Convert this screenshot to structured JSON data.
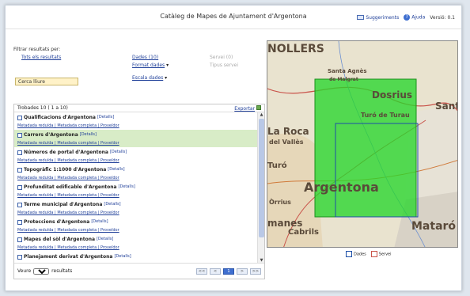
{
  "header": {
    "title": "Catàleg de Mapes de Ajuntament d'Argentona",
    "suggest_label": "Suggeriments",
    "help_label": "Ajuda",
    "version": "Versió: 0.1"
  },
  "filter": {
    "label": "Filtrar resultats per:",
    "all_results": "Tots els resultats",
    "dades": "Dades (10)",
    "servei": "Servei (0)",
    "format": "Format dades",
    "tipus": "Tipus servei",
    "escala": "Escala dades",
    "search_value": "Cerca lliure"
  },
  "results": {
    "count_label": "Trobades 10 ( 1 a 10)",
    "export_label": "Exportar",
    "detail_link": "[Detalls]",
    "links": "Metadada reduïda | Metadada completa | Proveïdor",
    "items": [
      {
        "title": "Qualificacions d'Argentona",
        "hl": false
      },
      {
        "title": "Carrers d'Argentona",
        "hl": true
      },
      {
        "title": "Números de portal d'Argentona",
        "hl": false
      },
      {
        "title": "Topogràfic 1:1000 d'Argentona",
        "hl": false
      },
      {
        "title": "Profunditat edificable d'Argentona",
        "hl": false
      },
      {
        "title": "Terme municipal d'Argentona",
        "hl": false
      },
      {
        "title": "Proteccions d'Argentona",
        "hl": false
      },
      {
        "title": "Mapes del sòl d'Argentona",
        "hl": false
      },
      {
        "title": "Planejament derivat d'Argentona",
        "hl": false
      }
    ],
    "pager_veure": "Veure",
    "pager_select": "25",
    "pager_suffix": "resultats",
    "pager_buttons": [
      "<<",
      "<",
      "1",
      ">",
      ">>"
    ]
  },
  "map": {
    "labels": [
      "NOLLERS",
      "Santa Agnès",
      "de Malgrat",
      "Dosrius",
      "Turó de Turau",
      "Sant A",
      "La Roca",
      "del Vallès",
      "Turó",
      "Argentona",
      "Òrrius",
      "manes",
      "Cabrils",
      "Mataró"
    ],
    "legend_dades": "Dades",
    "legend_servei": "Servei"
  }
}
